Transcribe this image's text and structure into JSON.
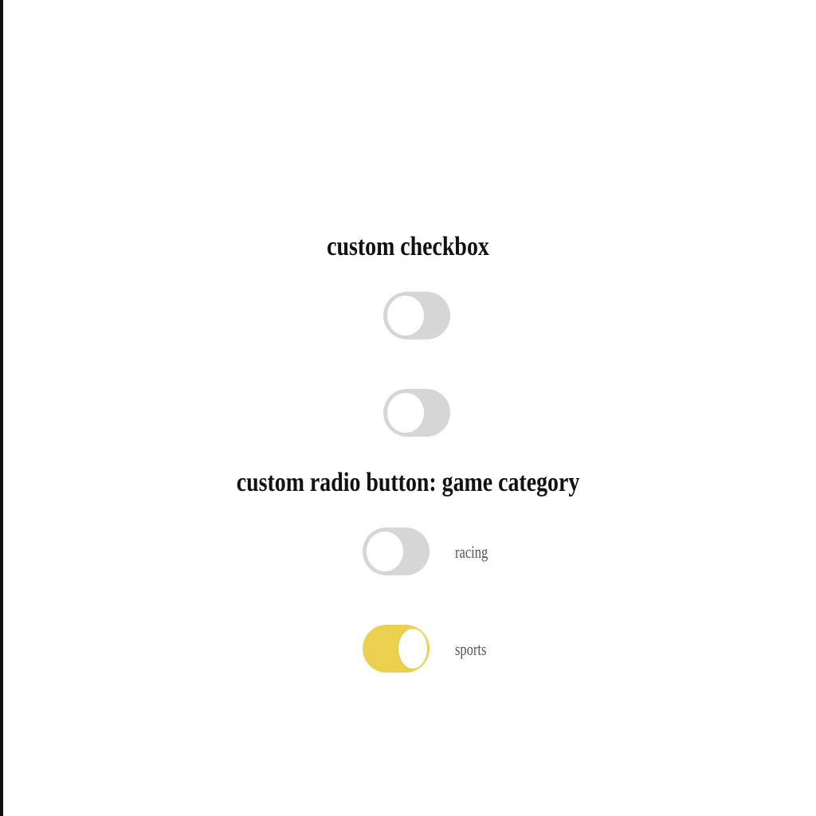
{
  "checkbox_section": {
    "heading": "custom checkbox",
    "toggles": [
      {
        "checked": false
      },
      {
        "checked": false
      }
    ]
  },
  "radio_section": {
    "heading": "custom radio button: game category",
    "options": [
      {
        "label": "racing",
        "selected": false
      },
      {
        "label": "sports",
        "selected": true
      }
    ]
  },
  "colors": {
    "toggle_off": "#d6d6d6",
    "toggle_on": "#ecd04f",
    "knob": "#ffffff",
    "heading_text": "#111111",
    "label_text": "#555555"
  }
}
